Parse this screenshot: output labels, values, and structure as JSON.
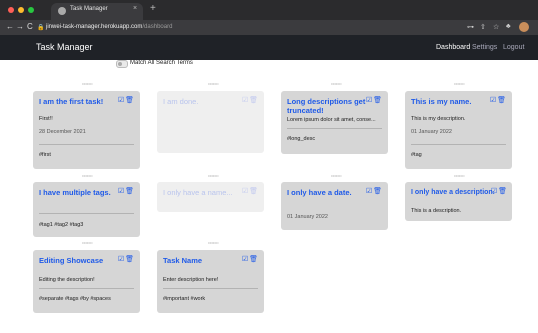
{
  "browser": {
    "tab_title": "Task Manager",
    "tab_close": "×",
    "new_tab": "+",
    "url_host": "jinwei-task-manager.herokuapp.com",
    "url_path": "/dashboard",
    "nav": {
      "back": "←",
      "forward": "→",
      "reload": "C",
      "lock": "🔒"
    },
    "right_icons": {
      "key": "⊶",
      "share": "⇧",
      "star": "☆",
      "ext": "♣"
    }
  },
  "navbar": {
    "brand": "Task Manager",
    "links": {
      "dashboard": "Dashboard",
      "settings": "Settings",
      "logout": "Logout"
    }
  },
  "search": {
    "match_all_label": "Match All Search Terms"
  },
  "handle_text": ":::::::::::::::::",
  "action_icons": {
    "edit": "☑",
    "delete": "🗑"
  },
  "tasks": [
    {
      "title": "I am the first task!",
      "description": "First!!",
      "date": "28 December 2021",
      "tags": "#first"
    },
    {
      "title": "I am done.",
      "description": "",
      "date": "",
      "tags": ""
    },
    {
      "title": "Long descriptions get truncated!",
      "description": "Lorem ipsum dolor sit amet, conse...",
      "date": "",
      "tags": "#long_desc"
    },
    {
      "title": "This is my name.",
      "description": "This is my description.",
      "date": "01 January 2022",
      "tags": "#tag"
    },
    {
      "title": "I have multiple tags.",
      "description": "",
      "date": "",
      "tags": "#tag1 #tag2 #tag3"
    },
    {
      "title": "I only have a name...",
      "description": "",
      "date": "",
      "tags": ""
    },
    {
      "title": "I only have a date.",
      "description": "",
      "date": "01 January 2022",
      "tags": ""
    },
    {
      "title": "I only have a description.",
      "description": "This is a description.",
      "date": "",
      "tags": ""
    },
    {
      "title": "Editing Showcase",
      "description": "Editing the description!",
      "date": "",
      "tags": "#separate #tags #by #spaces"
    },
    {
      "title": "Task Name",
      "description": "Enter description here!",
      "date": "",
      "tags": "#important #work"
    }
  ]
}
